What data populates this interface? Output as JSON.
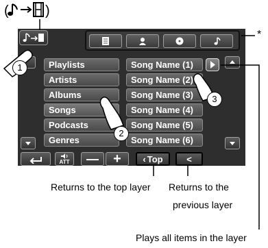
{
  "categories": [
    {
      "label": "Playlists"
    },
    {
      "label": "Artists"
    },
    {
      "label": "Albums"
    },
    {
      "label": "Songs"
    },
    {
      "label": "Podcasts"
    },
    {
      "label": "Genres"
    }
  ],
  "songs": [
    {
      "label": "Song Name (1)"
    },
    {
      "label": "Song Name (2)"
    },
    {
      "label": "Song Name (3)"
    },
    {
      "label": "Song Name (4)"
    },
    {
      "label": "Song Name (5)"
    },
    {
      "label": "Song Name (6)"
    }
  ],
  "tabs": [
    {
      "icon": "list-icon"
    },
    {
      "icon": "person-icon"
    },
    {
      "icon": "disc-icon"
    },
    {
      "icon": "music-note-icon"
    }
  ],
  "toolbar": {
    "att_label": "ATT",
    "minus_label": "—",
    "plus_label": "+",
    "top_label": "Top",
    "back_label": "<"
  },
  "callouts": {
    "step1": "1",
    "step2": "2",
    "step3": "3",
    "asterisk": "*",
    "returns_top": "Returns to the top layer",
    "returns_prev_1": "Returns to the",
    "returns_prev_2": "previous layer",
    "plays_all": "Plays all items in the layer"
  },
  "colors": {
    "screen_bg": "#2e2e2e",
    "button_gradient_top": "#6b6b6b",
    "button_gradient_bottom": "#4a4a4a"
  }
}
